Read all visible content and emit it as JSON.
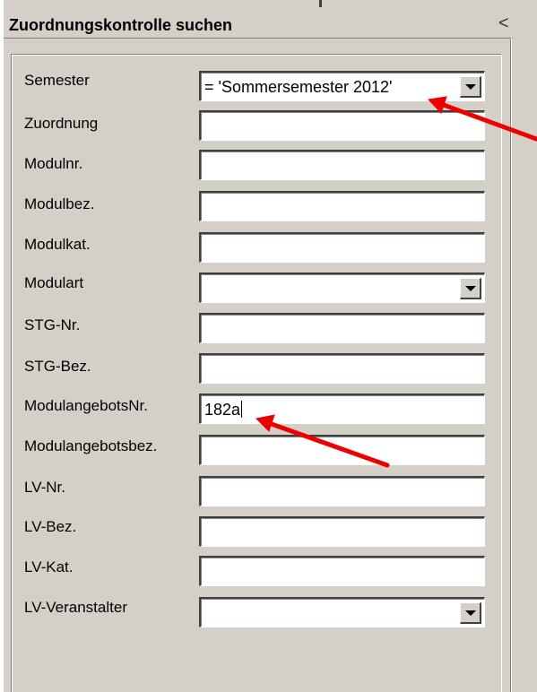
{
  "window": {
    "title": "Zuordnungskontrolle suchen",
    "collapse_glyph": "<"
  },
  "colors": {
    "window_bg": "#d4d0c8",
    "field_bg": "#ffffff",
    "annotation_arrow": "#ee0000"
  },
  "fields": [
    {
      "label": "Semester",
      "value": "= 'Sommersemester 2012'",
      "type": "dropdown"
    },
    {
      "label": "Zuordnung",
      "value": "",
      "type": "text"
    },
    {
      "label": "Modulnr.",
      "value": "",
      "type": "text"
    },
    {
      "label": "Modulbez.",
      "value": "",
      "type": "text"
    },
    {
      "label": "Modulkat.",
      "value": "",
      "type": "text"
    },
    {
      "label": "Modulart",
      "value": "",
      "type": "dropdown"
    },
    {
      "label": "STG-Nr.",
      "value": "",
      "type": "text"
    },
    {
      "label": "STG-Bez.",
      "value": "",
      "type": "text"
    },
    {
      "label": "ModulangebotsNr.",
      "value": "182a",
      "type": "text"
    },
    {
      "label": "Modulangebotsbez.",
      "value": "",
      "type": "text"
    },
    {
      "label": "LV-Nr.",
      "value": "",
      "type": "text"
    },
    {
      "label": "LV-Bez.",
      "value": "",
      "type": "text"
    },
    {
      "label": "LV-Kat.",
      "value": "",
      "type": "text"
    },
    {
      "label": "LV-Veranstalter",
      "value": "",
      "type": "dropdown"
    }
  ],
  "icons": {
    "dropdown": "chevron-down-icon",
    "collapse": "collapse-left-icon"
  }
}
